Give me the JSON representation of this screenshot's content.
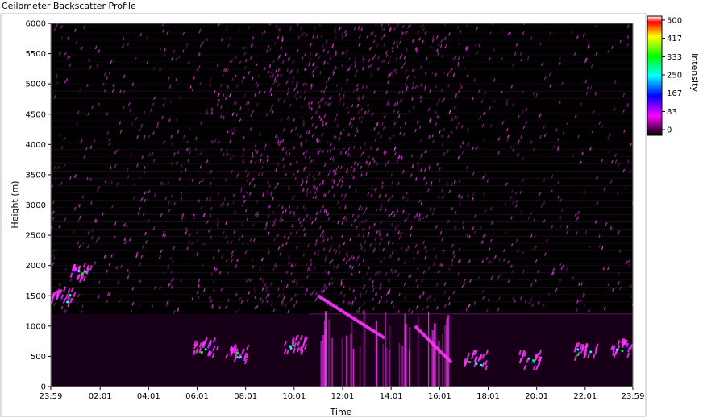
{
  "window_title": "Ceilometer Backscatter Profile",
  "colors": {
    "frame_border": "#bbbbbb",
    "plot_background": "#000000",
    "primary_signal": "#ff33ff",
    "colormap": [
      "#000000",
      "#ff00ff",
      "#0000ff",
      "#00ffff",
      "#00ff00",
      "#ffff00",
      "#ff0000",
      "#ffffff"
    ]
  },
  "chart_data": {
    "type": "heatmap",
    "title": "Ceilometer Backscatter Profile",
    "xlabel": "Time",
    "ylabel": "Height (m)",
    "x_ticks": [
      "23:59",
      "02:01",
      "04:01",
      "06:01",
      "08:01",
      "10:01",
      "12:01",
      "14:01",
      "16:01",
      "18:01",
      "20:01",
      "22:01",
      "23:59"
    ],
    "y_ticks": [
      0,
      500,
      1000,
      1500,
      2000,
      2500,
      3000,
      3500,
      4000,
      4500,
      5000,
      5500,
      6000
    ],
    "ylim": [
      0,
      6000
    ],
    "colorbar": {
      "label": "Intensity",
      "ticks": [
        0,
        83,
        167,
        250,
        333,
        417,
        500
      ],
      "range": [
        0,
        500
      ]
    },
    "grid": false,
    "features": {
      "boundary_layer_top_m": 1200,
      "rising_layer": {
        "start_time": "11:00",
        "start_height_m": 1500,
        "end_time": "13:45",
        "end_height_m": 800
      },
      "descending_layer": {
        "start_time": "15:00",
        "start_height_m": 1000,
        "end_time": "16:30",
        "end_height_m": 400
      },
      "clouds": [
        {
          "time": "00:30",
          "height_m": 1450
        },
        {
          "time": "01:15",
          "height_m": 1850
        },
        {
          "time": "06:20",
          "height_m": 600
        },
        {
          "time": "07:40",
          "height_m": 500
        },
        {
          "time": "10:00",
          "height_m": 650
        },
        {
          "time": "17:30",
          "height_m": 400
        },
        {
          "time": "19:40",
          "height_m": 400
        },
        {
          "time": "22:00",
          "height_m": 550
        },
        {
          "time": "23:30",
          "height_m": 600
        }
      ]
    }
  }
}
